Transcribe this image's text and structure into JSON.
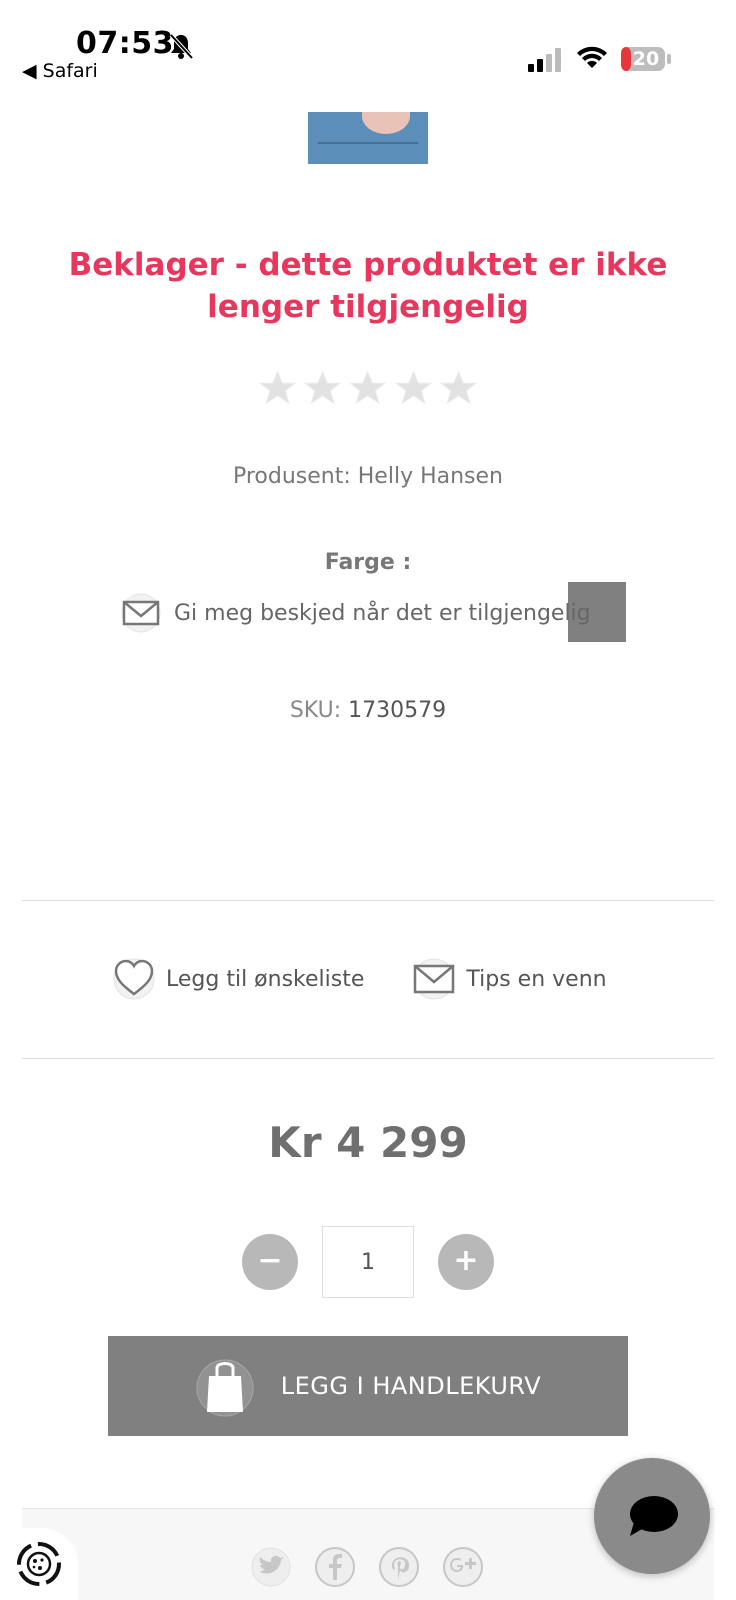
{
  "status_bar": {
    "time": "07:53",
    "back_label": "◀ Safari",
    "battery_level": "20"
  },
  "product": {
    "unavailable_title": "Beklager - dette produktet er ikke lenger tilgjengelig",
    "rating": 0,
    "rating_max": 5,
    "manufacturer_label": "Produsent: Helly Hansen",
    "color_label": "Farge :",
    "notify_label": "Gi meg beskjed når det er tilgjengelig",
    "sku_label": "SKU:",
    "sku_value": "1730579",
    "price": "Kr 4 299",
    "quantity": "1"
  },
  "actions": {
    "wishlist_label": "Legg til ønskeliste",
    "tip_friend_label": "Tips en venn",
    "add_to_cart_label": "LEGG I HANDLEKURV",
    "minus_label": "−",
    "plus_label": "+"
  },
  "social": [
    "twitter-icon",
    "facebook-icon",
    "pinterest-icon",
    "google-plus-icon"
  ],
  "colors": {
    "title": "#e8365d",
    "button": "#808080",
    "qty_button": "#b8b8b8"
  }
}
